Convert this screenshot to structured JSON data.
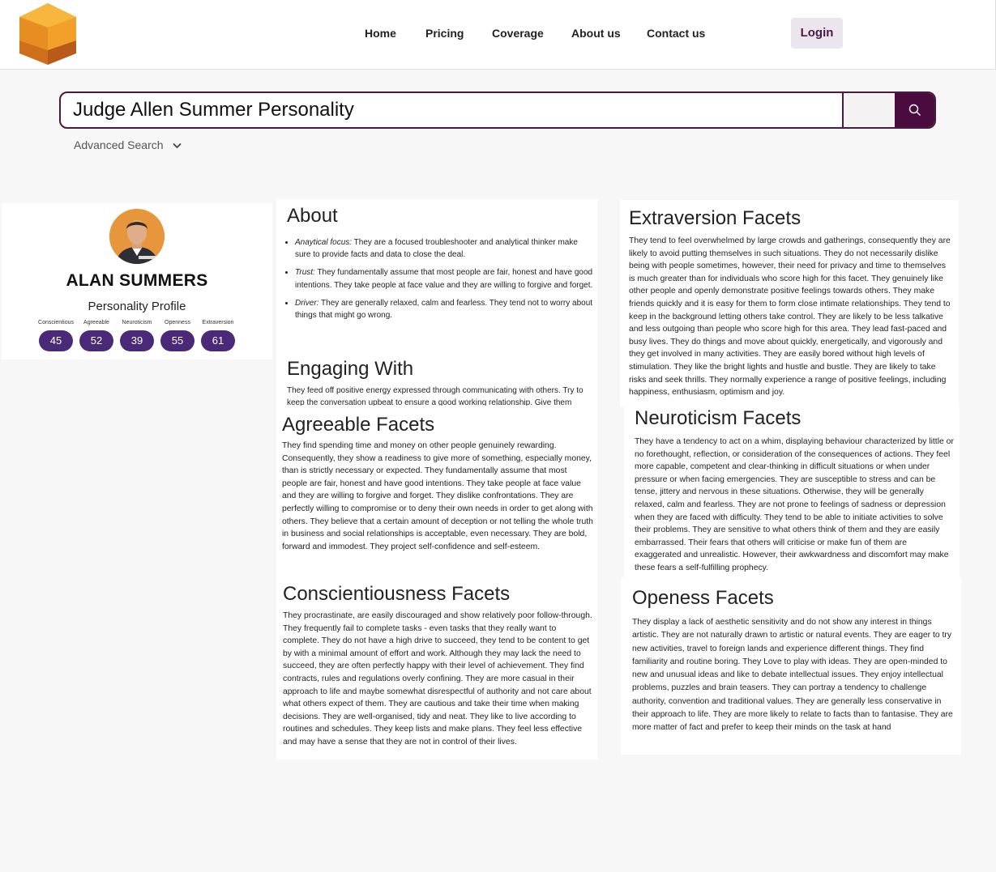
{
  "nav": {
    "items": [
      "Home",
      "Pricing",
      "Coverage",
      "About us",
      "Contact us"
    ],
    "login": "Login"
  },
  "search": {
    "value": "Judge Allen Summer Personality",
    "advanced": "Advanced Search"
  },
  "profile": {
    "name": "ALAN SUMMERS",
    "subtitle": "Personality Profile",
    "traits": [
      {
        "label": "Conscientious",
        "value": "45"
      },
      {
        "label": "Agreeable",
        "value": "52"
      },
      {
        "label": "Neuroticism",
        "value": "39"
      },
      {
        "label": "Openness",
        "value": "55"
      },
      {
        "label": "Extraversion",
        "value": "61"
      }
    ]
  },
  "about": {
    "title": "About",
    "items": [
      {
        "term": "Anaytical focus:",
        "text": " They are a focused troubleshooter and analytical thinker make sure to provide facts and data to close the deal."
      },
      {
        "term": "Trust:",
        "text": " They fundamentally assume that most people are fair, honest and have good intentions. They take people at face value and they are willing to forgive and forget."
      },
      {
        "term": "Driver:",
        "text": " They are generally relaxed, calm and fearless. They tend not to worry about things that might go wrong."
      }
    ]
  },
  "engaging": {
    "title": "Engaging With",
    "text": "They feed off positive energy expressed through communicating with others. Try to keep the conversation upbeat to ensure a good working relationship. Give them"
  },
  "agreeable": {
    "title": "Agreeable Facets",
    "text": "They find spending time and money on other people genuinely rewarding. Consequently, they show a readiness to give more of something, especially money, than is strictly necessary or expected. They fundamentally assume that most people are fair, honest and have good intentions. They take people at face value and they are willing to forgive and forget. They dislike confrontations. They are perfectly willing to compromise or to deny their own needs in order to get along with others. They believe that a certain amount of deception or not telling the whole truth in business and social relationships is acceptable, even necessary. They are bold, forward and immodest. They project self-confidence and self-esteem."
  },
  "conscientiousness": {
    "title": "Conscientiousness Facets",
    "text": "They procrastinate, are easily discouraged and show relatively poor follow-through. They frequently fail to complete tasks - even tasks that they really want to complete. They do not have a high drive to succeed, they tend to be content to get by with a minimal amount of effort and work. Although they may lack the need to succeed, they are often perfectly happy with their level of achievement. They find contracts, rules and regulations overly confining. They are more casual in their approach to life and maybe somewhat disrespectful of authority and not care about what others expect of them. They are cautious and take their time when making decisions. They are well-organised, tidy and neat. They like to live according to routines and schedules. They keep lists and make plans. They feel less effective and may have a sense that they are not in control of their lives."
  },
  "extraversion": {
    "title": "Extraversion Facets",
    "text": "They tend to feel overwhelmed by large crowds and gatherings, consequently they are likely to avoid putting themselves in such situations. They do not necessarily dislike being with people sometimes, however, their need for privacy and time to themselves is much greater than for individuals who score high for this facet. They genuinely like other people and openly demonstrate positive feelings towards others. They make friends quickly and it is easy for them to form close intimate relationships. They tend to keep in the background letting others take control. They are likely to be less talkative and less outgoing than people who score high for this area. They lead fast-paced and busy lives. They do things and move about quickly, energetically, and vigorously and they get involved in many activities. They are easily bored without high levels of stimulation. They like the bright lights and hustle and bustle. They are likely to take risks and seek thrills. They normally experience a range of positive feelings, including happiness, enthusiasm, optimism and joy."
  },
  "neuroticism": {
    "title": "Neuroticism Facets",
    "text": "They have a tendency to act on a whim, displaying behaviour characterized by little or no forethought, reflection, or consideration of the consequences of actions. They feel more capable, competent and clear-thinking in difficult situations or when under pressure or when facing emergencies. They are susceptible to stress and can be tense, jittery and nervous in these situations. Otherwise, they will be generally relaxed, calm and fearless. They are not prone to feelings of sadness or depression when they are faced with difficulty. They tend to be able to initiate activities to solve their problems. They are sensitive to what others think of them and they are easily embarrassed. Their fears that others will criticise or make fun of them are exaggerated and unrealistic. However, their awkwardness and discomfort may make these fears a self-fulfilling prophecy."
  },
  "openness": {
    "title": "Openess Facets",
    "text": "They display a lack of aesthetic sensitivity and do not show any interest in things artistic. They are not naturally drawn to artistic or natural events. They are eager to try new activities, travel to foreign lands and experience different things. They find familiarity and routine boring. They Love to play with ideas. They are open-minded to new and unusual ideas and like to debate intellectual issues. They enjoy intellectual problems, puzzles and brain teasers. They can portray a tendency to challenge authority, convention and traditional values. They are generally less conservative in their approach to life. They are more likely to relate to facts than to fantasise. They are more matter of fact and prefer to keep their minds on the task at hand"
  },
  "colors": {
    "brand": "#4a1942",
    "badge": "#4a2a78",
    "logo_orange": "#f2a029"
  }
}
